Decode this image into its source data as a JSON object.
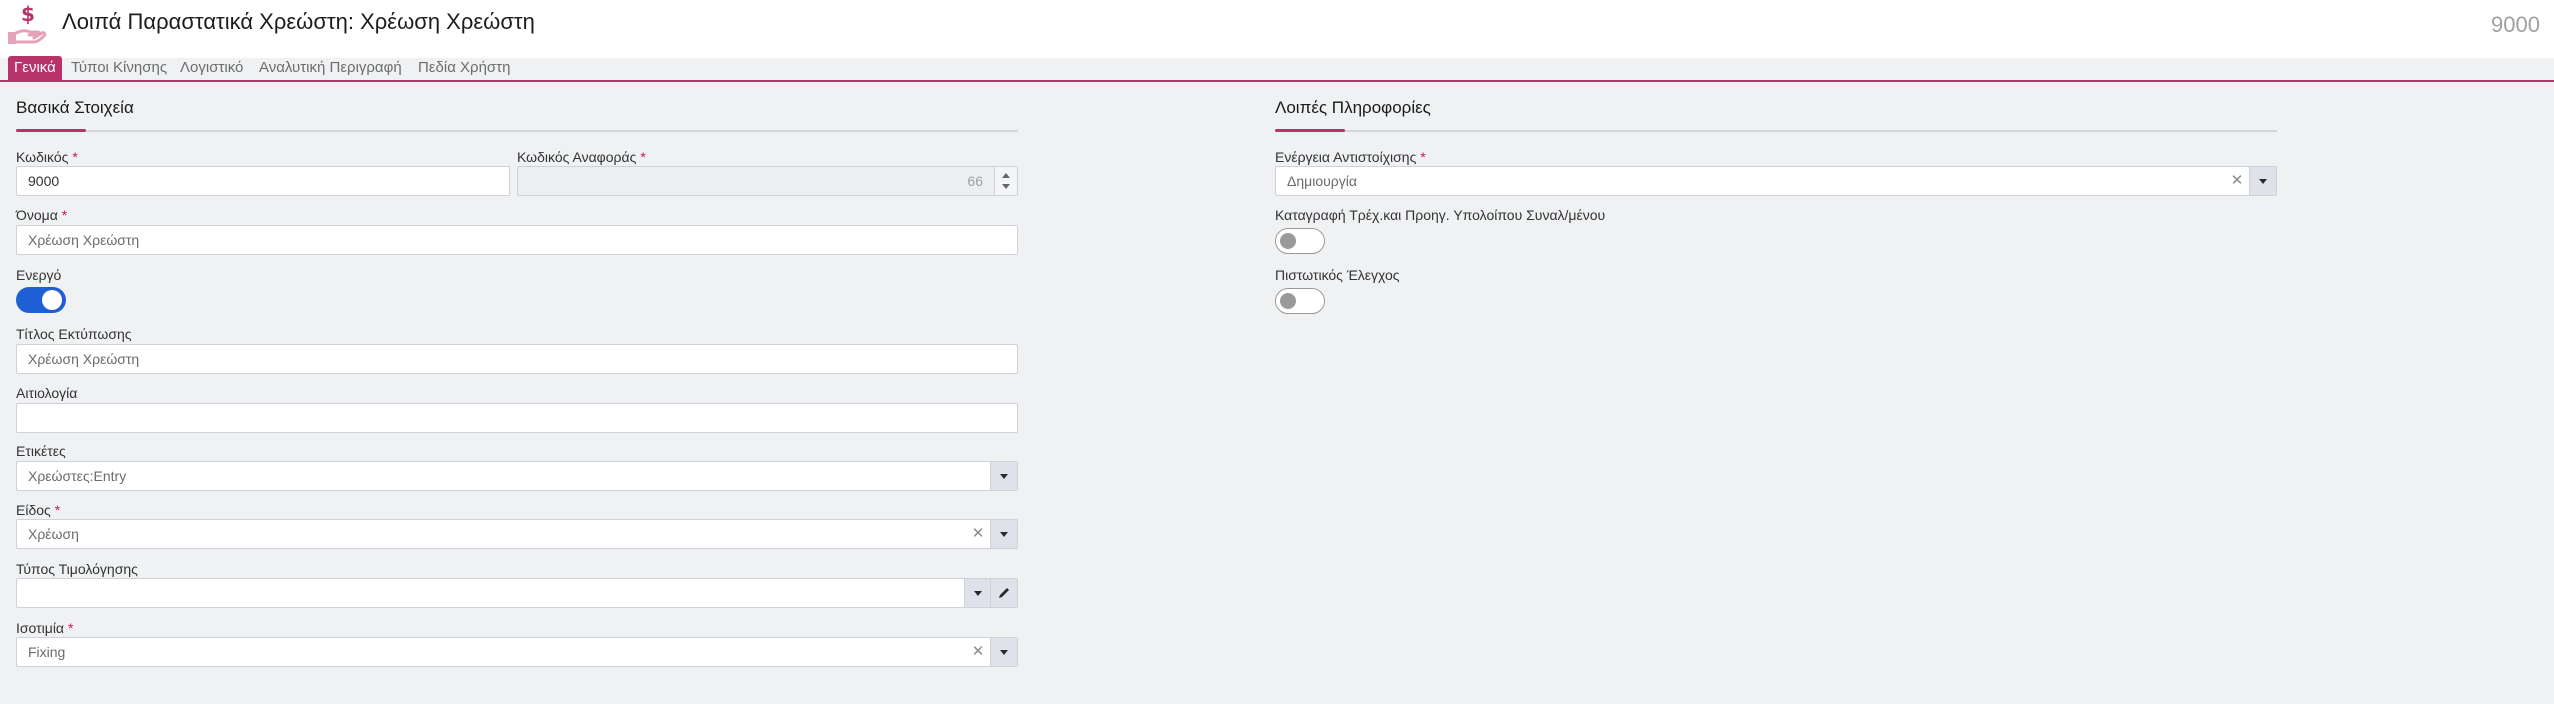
{
  "header": {
    "title": "Λοιπά Παραστατικά Χρεώστη: Χρέωση Χρεώστη",
    "record_code": "9000",
    "icon": "hand-dollar-icon"
  },
  "tabs": [
    {
      "label": "Γενικά",
      "active": true
    },
    {
      "label": "Τύποι Κίνησης",
      "active": false
    },
    {
      "label": "Λογιστικό",
      "active": false
    },
    {
      "label": "Αναλυτική Περιγραφή",
      "active": false
    },
    {
      "label": "Πεδία Χρήστη",
      "active": false
    }
  ],
  "basic": {
    "title": "Βασικά Στοιχεία",
    "code": {
      "label": "Κωδικός",
      "required_mark": "*",
      "value": "9000"
    },
    "ref_code": {
      "label": "Κωδικός Αναφοράς",
      "required_mark": "*",
      "value": "66"
    },
    "name": {
      "label": "Όνομα",
      "required_mark": "*",
      "value": "Χρέωση Χρεώστη"
    },
    "active": {
      "label": "Ενεργό",
      "checked": true
    },
    "print_title": {
      "label": "Τίτλος Εκτύπωσης",
      "value": "Χρέωση Χρεώστη"
    },
    "reason": {
      "label": "Αιτιολογία",
      "value": ""
    },
    "tags": {
      "label": "Ετικέτες",
      "value": "Χρεώστες:Entry"
    },
    "kind": {
      "label": "Είδος",
      "required_mark": "*",
      "value": "Χρέωση"
    },
    "pricing_type": {
      "label": "Τύπος Τιμολόγησης",
      "value": ""
    },
    "parity": {
      "label": "Ισοτιμία",
      "required_mark": "*",
      "value": "Fixing"
    }
  },
  "other": {
    "title": "Λοιπές Πληροφορίες",
    "matching_action": {
      "label": "Ενέργεια Αντιστοίχισης",
      "required_mark": "*",
      "value": "Δημιουργία"
    },
    "record_balance": {
      "label": "Καταγραφή Τρέχ.και Προηγ. Υπολοίπου Συναλ/μένου",
      "checked": false
    },
    "credit_check": {
      "label": "Πιστωτικός Έλεγχος",
      "checked": false
    }
  },
  "colors": {
    "accent": "#b8336a",
    "toggle_on": "#1f5fd6",
    "background": "#eff1f3"
  }
}
